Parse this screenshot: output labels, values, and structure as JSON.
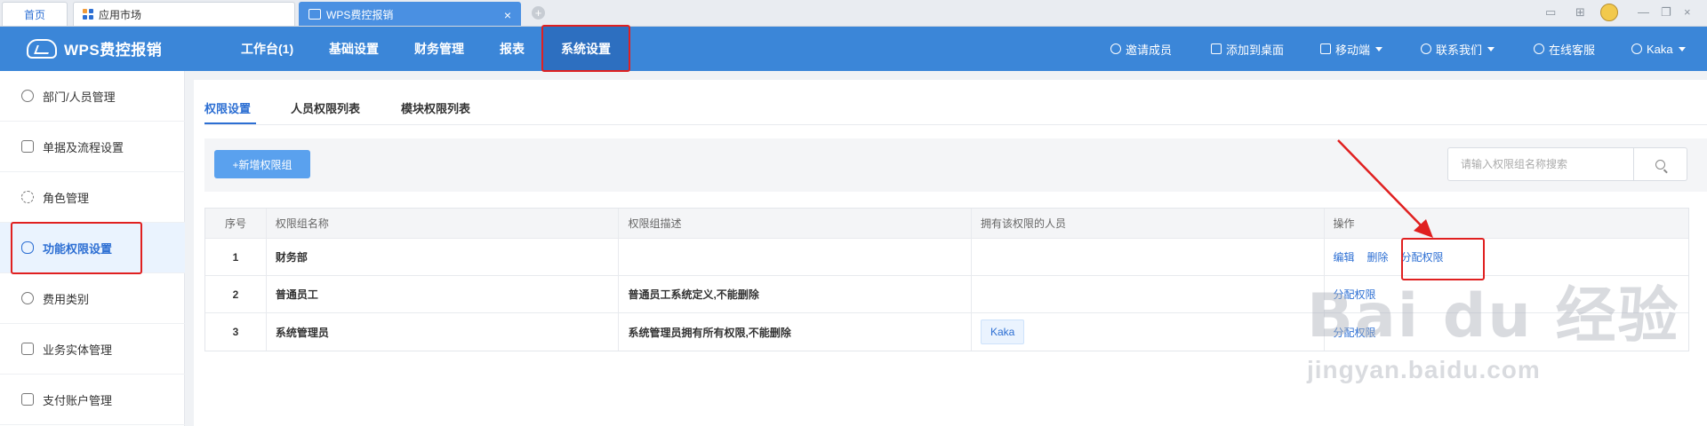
{
  "browser": {
    "tabs": [
      {
        "label": "首页"
      },
      {
        "label": "应用市场"
      },
      {
        "label": "WPS费控报销"
      }
    ],
    "close_glyph": "×",
    "new_tab_glyph": "+",
    "window_controls": [
      "▭",
      "⊞",
      "—",
      "❐",
      "×"
    ]
  },
  "app": {
    "logo": "WPS费控报销",
    "nav": [
      {
        "label": "工作台(1)"
      },
      {
        "label": "基础设置"
      },
      {
        "label": "财务管理"
      },
      {
        "label": "报表"
      },
      {
        "label": "系统设置",
        "active": true
      }
    ],
    "right_menu": [
      {
        "label": "邀请成员",
        "icon": "plus-circle-icon"
      },
      {
        "label": "添加到桌面",
        "icon": "monitor-icon"
      },
      {
        "label": "移动端",
        "icon": "grid-icon"
      },
      {
        "label": "联系我们",
        "icon": "wechat-icon"
      },
      {
        "label": "在线客服",
        "icon": "smile-icon"
      },
      {
        "label": "Kaka",
        "icon": "user-icon"
      }
    ],
    "accent_color": "#3b86d8"
  },
  "sidebar": {
    "items": [
      {
        "label": "部门/人员管理",
        "icon": "user-icon"
      },
      {
        "label": "单据及流程设置",
        "icon": "printer-icon"
      },
      {
        "label": "角色管理",
        "icon": "loading-icon"
      },
      {
        "label": "功能权限设置",
        "icon": "toggle-icon",
        "active": true
      },
      {
        "label": "费用类别",
        "icon": "database-icon"
      },
      {
        "label": "业务实体管理",
        "icon": "building-icon"
      },
      {
        "label": "支付账户管理",
        "icon": "card-icon"
      }
    ]
  },
  "main": {
    "subtabs": [
      {
        "label": "权限设置",
        "active": true
      },
      {
        "label": "人员权限列表"
      },
      {
        "label": "模块权限列表"
      }
    ],
    "add_button": "+新增权限组",
    "search": {
      "placeholder": "请输入权限组名称搜索",
      "value": ""
    },
    "table": {
      "headers": [
        "序号",
        "权限组名称",
        "权限组描述",
        "拥有该权限的人员",
        "操作"
      ],
      "rows": [
        {
          "no": "1",
          "name": "财务部",
          "desc": "",
          "members": "",
          "actions": [
            "编辑",
            "删除",
            "分配权限"
          ]
        },
        {
          "no": "2",
          "name": "普通员工",
          "desc": "普通员工系统定义,不能删除",
          "members": "",
          "actions": [
            "分配权限"
          ]
        },
        {
          "no": "3",
          "name": "系统管理员",
          "desc": "系统管理员拥有所有权限,不能删除",
          "members": "Kaka",
          "actions": [
            "分配权限"
          ]
        }
      ]
    }
  },
  "watermark": {
    "big": "Bai du 经验",
    "small": "jingyan.baidu.com"
  }
}
